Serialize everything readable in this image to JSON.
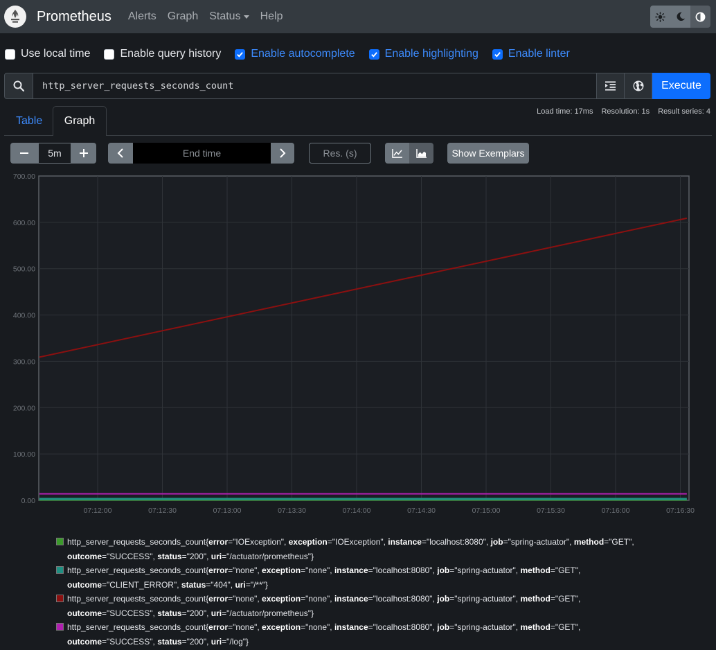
{
  "nav": {
    "brand": "Prometheus",
    "links": [
      {
        "label": "Alerts",
        "dropdown": false
      },
      {
        "label": "Graph",
        "dropdown": false
      },
      {
        "label": "Status",
        "dropdown": true
      },
      {
        "label": "Help",
        "dropdown": false
      }
    ],
    "theme": {
      "icons": [
        "sun-icon",
        "moon-icon",
        "half-circle-icon"
      ],
      "active": "half-circle-icon"
    }
  },
  "options": [
    {
      "label": "Use local time",
      "checked": false
    },
    {
      "label": "Enable query history",
      "checked": false
    },
    {
      "label": "Enable autocomplete",
      "checked": true
    },
    {
      "label": "Enable highlighting",
      "checked": true
    },
    {
      "label": "Enable linter",
      "checked": true
    }
  ],
  "query": {
    "expression": "http_server_requests_seconds_count",
    "execute_label": "Execute"
  },
  "stats": {
    "load_time": "Load time: 17ms",
    "resolution": "Resolution: 1s",
    "result_series": "Result series: 4"
  },
  "tabs": [
    {
      "label": "Table",
      "active": false
    },
    {
      "label": "Graph",
      "active": true
    }
  ],
  "controls": {
    "range_value": "5m",
    "end_time_placeholder": "End time",
    "res_placeholder": "Res. (s)",
    "exemplars_label": "Show Exemplars",
    "chart_mode": "stacked"
  },
  "chart_data": {
    "type": "line",
    "ylim": [
      0,
      700
    ],
    "yticks": [
      "0.00",
      "100.00",
      "200.00",
      "300.00",
      "400.00",
      "500.00",
      "600.00",
      "700.00"
    ],
    "xticks": [
      "07:12:00",
      "07:12:30",
      "07:13:00",
      "07:13:30",
      "07:14:00",
      "07:14:30",
      "07:15:00",
      "07:15:30",
      "07:16:00",
      "07:16:30"
    ],
    "grid": true,
    "series": [
      {
        "color": "#3b9a2b",
        "x_start": "07:11:33",
        "x_end": "07:16:33",
        "values": [
          0,
          0
        ]
      },
      {
        "color": "#1f8f82",
        "x_start": "07:11:33",
        "x_end": "07:16:33",
        "values": [
          3,
          3
        ]
      },
      {
        "color": "#8b1010",
        "x_start": "07:11:33",
        "x_end": "07:16:33",
        "values": [
          309,
          609
        ]
      },
      {
        "color": "#b01fb0",
        "x_start": "07:11:33",
        "x_end": "07:16:33",
        "values": [
          14,
          14
        ]
      }
    ]
  },
  "legend": [
    {
      "color": "#3b9a2b",
      "metric": "http_server_requests_seconds_count",
      "labels": [
        [
          "error",
          "IOException"
        ],
        [
          "exception",
          "IOException"
        ],
        [
          "instance",
          "localhost:8080"
        ],
        [
          "job",
          "spring-actuator"
        ],
        [
          "method",
          "GET"
        ],
        [
          "outcome",
          "SUCCESS"
        ],
        [
          "status",
          "200"
        ],
        [
          "uri",
          "/actuator/prometheus"
        ]
      ]
    },
    {
      "color": "#1f8f82",
      "metric": "http_server_requests_seconds_count",
      "labels": [
        [
          "error",
          "none"
        ],
        [
          "exception",
          "none"
        ],
        [
          "instance",
          "localhost:8080"
        ],
        [
          "job",
          "spring-actuator"
        ],
        [
          "method",
          "GET"
        ],
        [
          "outcome",
          "CLIENT_ERROR"
        ],
        [
          "status",
          "404"
        ],
        [
          "uri",
          "/**"
        ]
      ]
    },
    {
      "color": "#8b1010",
      "metric": "http_server_requests_seconds_count",
      "labels": [
        [
          "error",
          "none"
        ],
        [
          "exception",
          "none"
        ],
        [
          "instance",
          "localhost:8080"
        ],
        [
          "job",
          "spring-actuator"
        ],
        [
          "method",
          "GET"
        ],
        [
          "outcome",
          "SUCCESS"
        ],
        [
          "status",
          "200"
        ],
        [
          "uri",
          "/actuator/prometheus"
        ]
      ]
    },
    {
      "color": "#b01fb0",
      "metric": "http_server_requests_seconds_count",
      "labels": [
        [
          "error",
          "none"
        ],
        [
          "exception",
          "none"
        ],
        [
          "instance",
          "localhost:8080"
        ],
        [
          "job",
          "spring-actuator"
        ],
        [
          "method",
          "GET"
        ],
        [
          "outcome",
          "SUCCESS"
        ],
        [
          "status",
          "200"
        ],
        [
          "uri",
          "/log"
        ]
      ]
    }
  ],
  "colors": {
    "accent": "#0d6efd",
    "navbar": "#343a40",
    "background": "#181b1f"
  }
}
